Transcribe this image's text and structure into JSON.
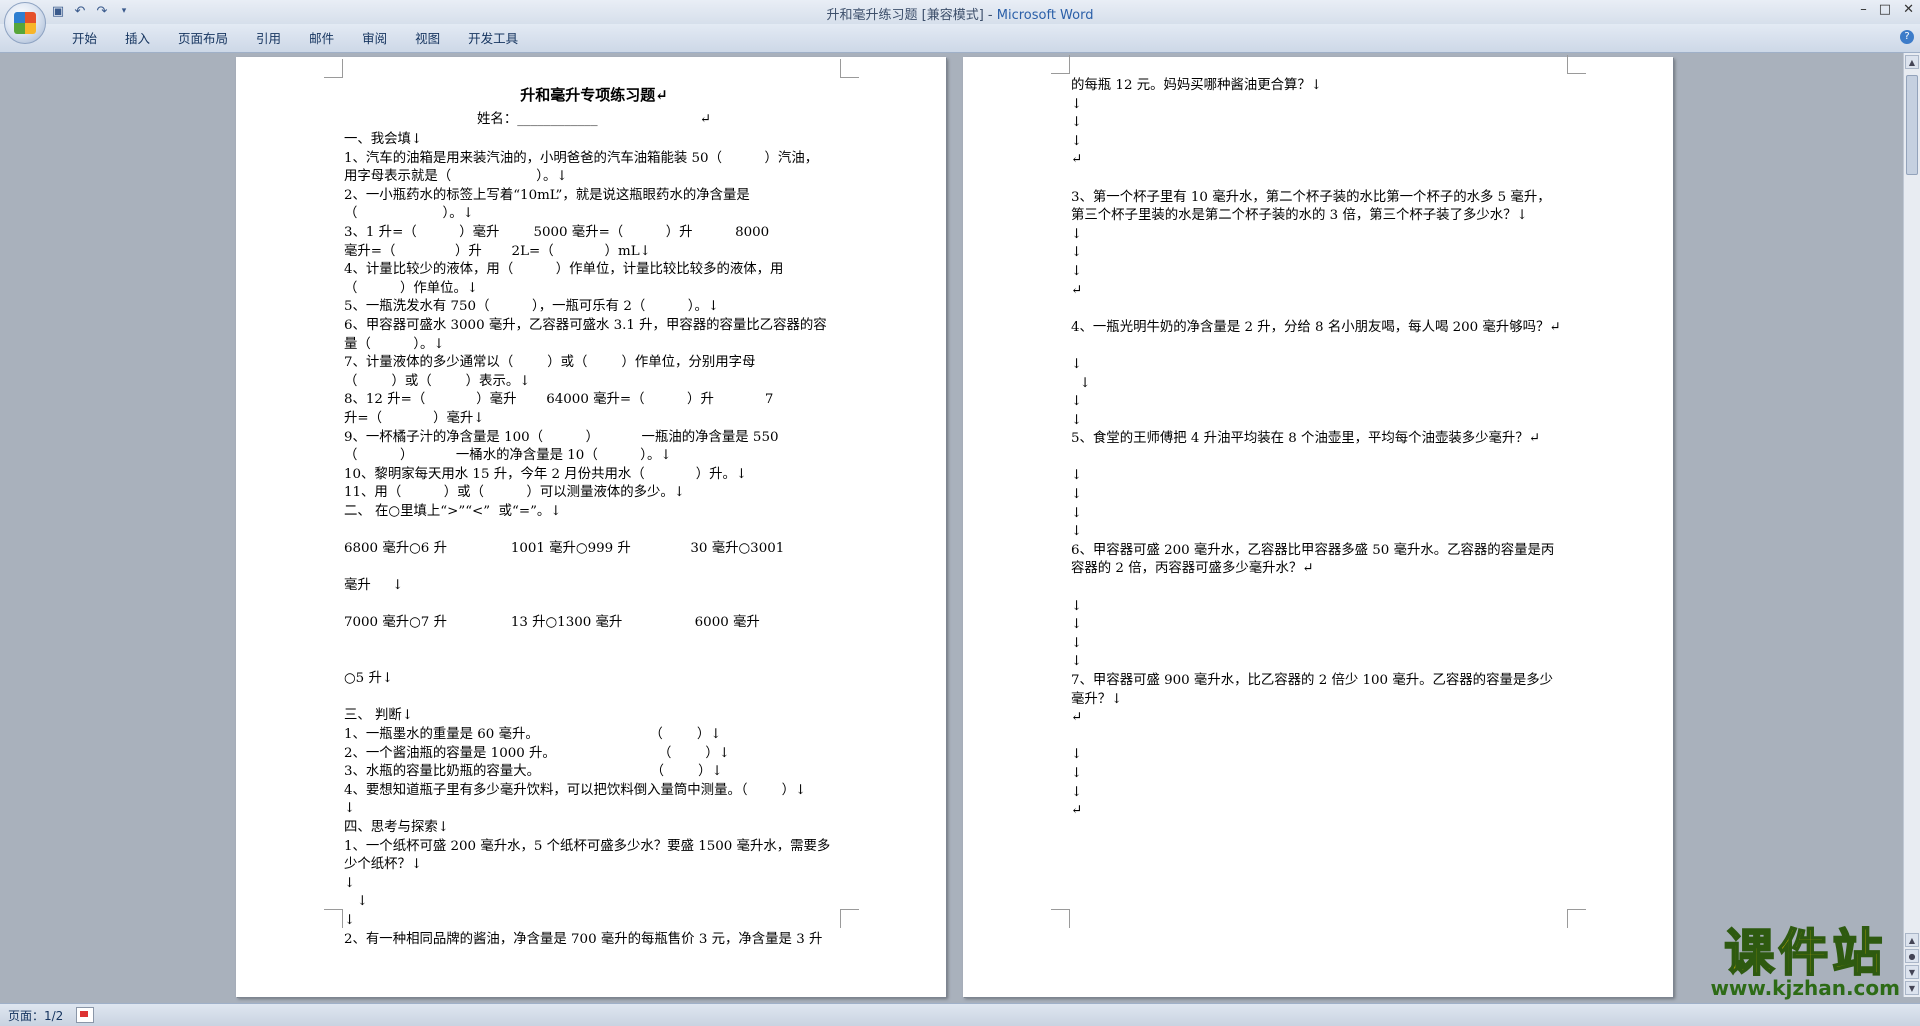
{
  "window": {
    "title": "升和毫升练习题 [兼容模式] - ",
    "app_name": "Microsoft Word",
    "controls": [
      "–",
      "□",
      "✕"
    ]
  },
  "ribbon": {
    "tabs": [
      "开始",
      "插入",
      "页面布局",
      "引用",
      "邮件",
      "审阅",
      "视图",
      "开发工具"
    ]
  },
  "page1_lines": [
    "升和毫升专项练习题↵",
    "姓名：____________                        ↵",
    "一、我会填↓",
    "1、汽车的油箱是用来装汽油的，小明爸爸的汽车油箱能装 50（          ）汽油，",
    "用字母表示就是（                    ）。↓",
    "2、一小瓶药水的标签上写着“10mL”，就是说这瓶眼药水的净含量是",
    "（                    ）。↓",
    "3、1 升=（          ）毫升        5000 毫升=（          ）升          8000",
    "毫升=（              ）升       2L=（            ）mL↓",
    "4、计量比较少的液体，用（          ）作单位，计量比较比较多的液体，用",
    "（          ）作单位。↓",
    "5、一瓶洗发水有 750（          ），一瓶可乐有 2（          ）。↓",
    "6、甲容器可盛水 3000 毫升，乙容器可盛水 3.1 升，甲容器的容量比乙容器的容",
    "量（          ）。↓",
    "7、计量液体的多少通常以（        ）或（        ）作单位，分别用字母",
    "（        ）或（        ）表示。↓",
    "8、12 升=（            ）毫升       64000 毫升=（          ）升            7",
    "升=（            ）毫升↓",
    "9、一杯橘子汁的净含量是 100（          ）          一瓶油的净含量是 550",
    "（          ）          一桶水的净含量是 10（          ）。↓",
    "10、黎明家每天用水 15 升，今年 2 月份共用水（            ）升。↓",
    "11、用（          ）或（          ）可以测量液体的多少。↓",
    "二、 在○里填上“>”“<”  或“=”。↓",
    "",
    "6800 毫升○6 升               1001 毫升○999 升              30 毫升○3001",
    "",
    "毫升     ↓",
    "",
    "7000 毫升○7 升               13 升○1300 毫升                 6000 毫升",
    "",
    "",
    "○5 升↓",
    "",
    "三、 判断↓",
    "1、一瓶墨水的重量是 60 毫升。                          （        ）↓",
    "2、一个酱油瓶的容量是 1000 升。                        （        ）↓",
    "3、水瓶的容量比奶瓶的容量大。                          （        ）↓",
    "4、要想知道瓶子里有多少毫升饮料，可以把饮料倒入量筒中测量。（        ）↓",
    "↓",
    "四、思考与探索↓",
    "1、一个纸杯可盛 200 毫升水，5 个纸杯可盛多少水？要盛 1500 毫升水，需要多",
    "少个纸杯？↓",
    "↓",
    "   ↓",
    "↓",
    "2、有一种相同品牌的酱油，净含量是 700 毫升的每瓶售价 3 元，净含量是 3 升"
  ],
  "page2_lines": [
    "的每瓶 12 元。妈妈买哪种酱油更合算？↓",
    "↓",
    "↓",
    "↓",
    "↵",
    "",
    "3、第一个杯子里有 10 毫升水，第二个杯子装的水比第一个杯子的水多 5 毫升，",
    "第三个杯子里装的水是第二个杯子装的水的 3 倍，第三个杯子装了多少水？↓",
    "↓",
    "↓",
    "↓",
    "↵",
    "",
    "4、一瓶光明牛奶的净含量是 2 升，分给 8 名小朋友喝，每人喝 200 毫升够吗？↵",
    "",
    "↓",
    "  ↓",
    "↓",
    "↓",
    "5、食堂的王师傅把 4 升油平均装在 8 个油壶里，平均每个油壶装多少毫升？↵",
    "",
    "↓",
    "↓",
    "↓",
    "↓",
    "6、甲容器可盛 200 毫升水，乙容器比甲容器多盛 50 毫升水。乙容器的容量是丙",
    "容器的 2 倍，丙容器可盛多少毫升水？↵",
    "",
    "↓",
    "↓",
    "↓",
    "↓",
    "7、甲容器可盛 900 毫升水，比乙容器的 2 倍少 100 毫升。乙容器的容量是多少",
    "毫升？↓",
    "↵",
    "",
    "↓",
    "↓",
    "↓",
    "↵"
  ],
  "status": {
    "page_count": "页面：1/2"
  },
  "watermark": {
    "text": "课件站",
    "url": "www.kjzhan.com"
  },
  "colors": {
    "app_name": "#2a5fa8",
    "watermark_fill": "#f2c400",
    "watermark_url": "#2d6b16"
  }
}
